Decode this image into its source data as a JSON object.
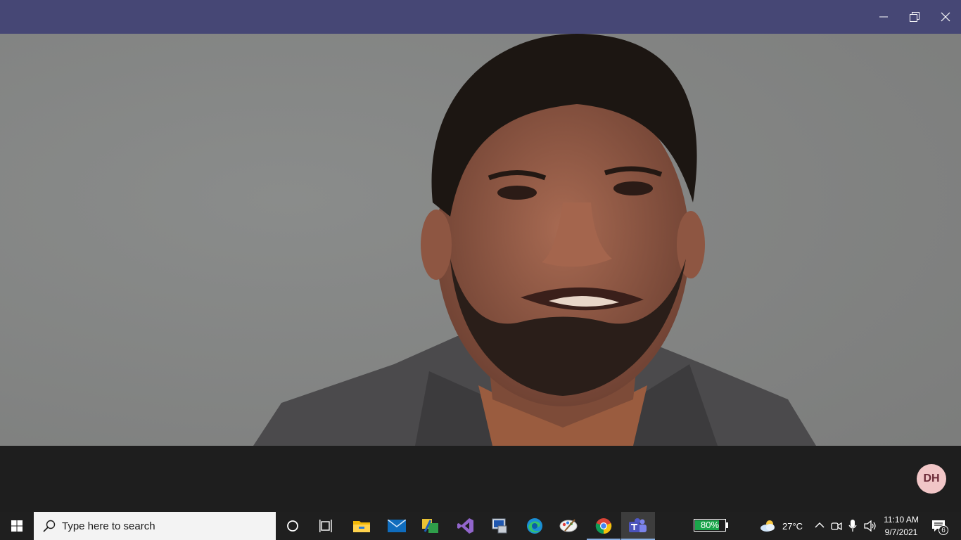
{
  "window": {
    "controls": [
      {
        "name": "minimize-icon"
      },
      {
        "name": "maximize-icon"
      },
      {
        "name": "close-icon"
      }
    ]
  },
  "video": {
    "participant_initials": "DH"
  },
  "taskbar": {
    "search_placeholder": "Type here to search",
    "apps": [
      {
        "name": "cortana-icon"
      },
      {
        "name": "task-view-icon"
      },
      {
        "name": "file-explorer-icon"
      },
      {
        "name": "mail-icon"
      },
      {
        "name": "app-icon"
      },
      {
        "name": "visual-studio-icon"
      },
      {
        "name": "app-icon"
      },
      {
        "name": "edge-icon"
      },
      {
        "name": "app-icon"
      },
      {
        "name": "chrome-icon"
      },
      {
        "name": "teams-icon",
        "active": true
      }
    ],
    "battery": {
      "label": "80%",
      "level": 0.8,
      "fill_color": "#1aa64a"
    },
    "weather": {
      "temperature": "27°C",
      "icon": "partly-cloudy-icon"
    },
    "tray_icons": [
      "chevron-up-icon",
      "meet-now-icon",
      "microphone-icon",
      "speaker-icon"
    ],
    "clock": {
      "time": "11:10 AM",
      "date": "9/7/2021"
    },
    "notifications": {
      "count": "6",
      "icon": "action-center-icon"
    }
  },
  "colors": {
    "title_bar": "#464775",
    "taskbar": "#1f1f1f",
    "avatar_bg": "#f1c6c7",
    "avatar_text": "#6b2a37"
  }
}
